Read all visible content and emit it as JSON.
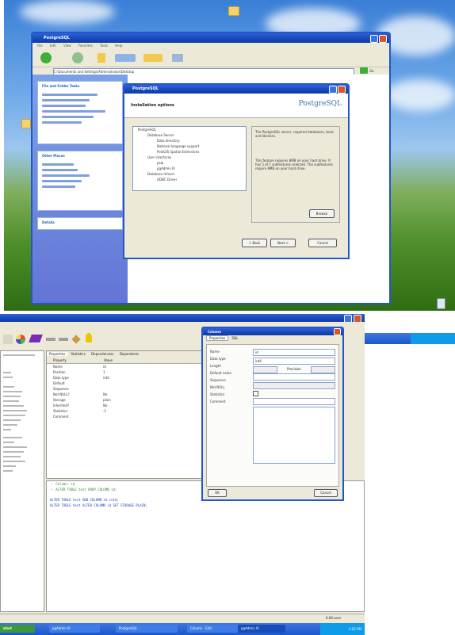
{
  "desktop": {
    "explorer": {
      "title": "PostgreSQL",
      "menu_items": [
        "File",
        "Edit",
        "View",
        "Favorites",
        "Tools",
        "Help"
      ],
      "address_value": "C:\\Documents and Settings\\Administrator\\Desktop",
      "go_label": "Go",
      "task_headers": [
        "File and Folder Tasks",
        "Other Places",
        "Details"
      ]
    },
    "installer": {
      "title": "PostgreSQL",
      "heading": "Installation options",
      "logo_text": "PostgreSQL",
      "tree_items": [
        "PostgreSQL",
        "Database Server",
        "Data directory",
        "National language support",
        "PostGIS Spatial Extensions",
        "User interfaces",
        "psql",
        "pgAdmin III",
        "Database drivers",
        "ODBC Driver"
      ],
      "desc_top": "The PostgreSQL server, required databases, tools and libraries.",
      "desc_bottom": "This feature requires 8MB on your hard drive. It has 5 of 7 subfeatures selected. The subfeatures require 8MB on your hard drive.",
      "browse_label": "Browse",
      "back_label": "< Back",
      "next_label": "Next >",
      "cancel_label": "Cancel"
    },
    "icons": [
      "folder-icon",
      "recycle-bin-icon"
    ],
    "accent": "#245edb"
  },
  "pgadmin": {
    "tabs": [
      "Properties",
      "Statistics",
      "Dependencies",
      "Dependents"
    ],
    "prop_headers": [
      "Property",
      "Value"
    ],
    "properties": [
      {
        "name": "Name",
        "value": "id"
      },
      {
        "name": "Position",
        "value": "1"
      },
      {
        "name": "Data type",
        "value": "int4"
      },
      {
        "name": "Default",
        "value": ""
      },
      {
        "name": "Sequence",
        "value": ""
      },
      {
        "name": "Not NULL?",
        "value": "No"
      },
      {
        "name": "Storage",
        "value": "plain"
      },
      {
        "name": "Inherited?",
        "value": "No"
      },
      {
        "name": "Statistics",
        "value": "-1"
      },
      {
        "name": "Comment",
        "value": ""
      }
    ],
    "sql_lines": [
      "-- Column: id",
      "-- ALTER TABLE test DROP COLUMN id;",
      "ALTER TABLE test ADD COLUMN id int4;",
      "ALTER TABLE test ALTER COLUMN id SET STORAGE PLAIN;"
    ],
    "column_dialog": {
      "title": "Column",
      "tabs": [
        "Properties",
        "SQL"
      ],
      "labels": [
        "Name",
        "Data type",
        "Length",
        "Default value",
        "Sequence",
        "Not NULL",
        "Statistics",
        "Comment"
      ],
      "name_value": "id",
      "type_value": "int4",
      "precision_label": "Precision",
      "ok_label": "OK",
      "cancel_label": "Cancel"
    },
    "status": "0.00 secs",
    "taskbar_items": [
      "start",
      "pgAdmin III",
      "PostgreSQL",
      "Column - Edit",
      "pgAdmin III"
    ],
    "clock": "2:02 PM"
  }
}
